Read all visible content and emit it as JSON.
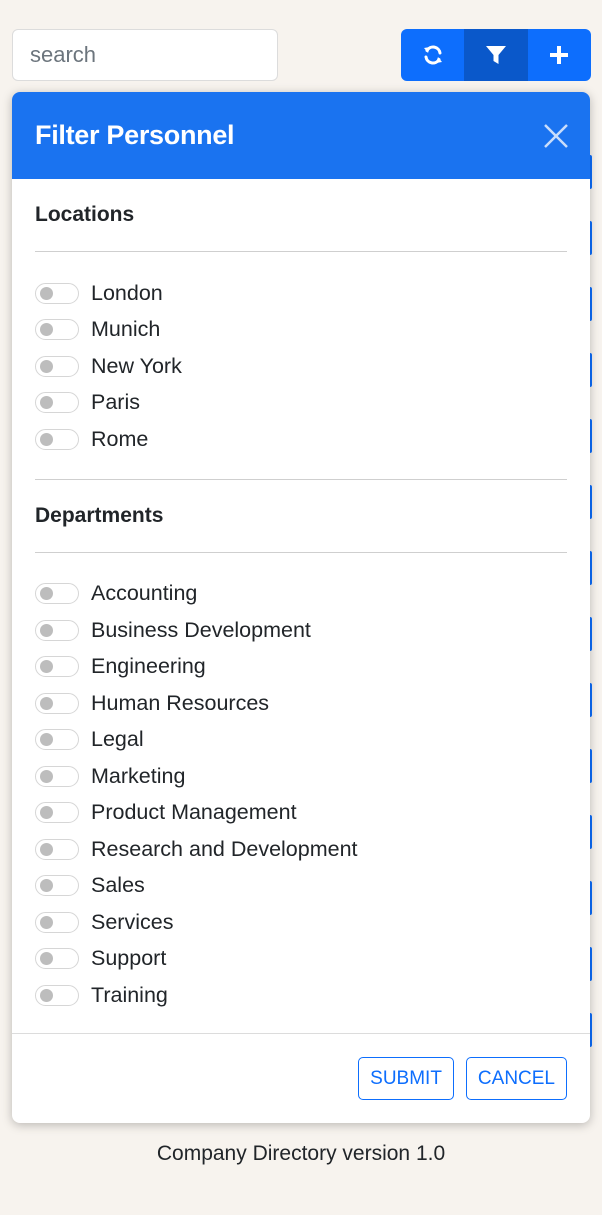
{
  "search": {
    "placeholder": "search"
  },
  "toolbar": {
    "buttons": [
      {
        "icon": "refresh-icon",
        "active": false
      },
      {
        "icon": "filter-icon",
        "active": true
      },
      {
        "icon": "plus-icon",
        "active": false
      }
    ]
  },
  "modal": {
    "title": "Filter Personnel",
    "locations_title": "Locations",
    "locations": [
      "London",
      "Munich",
      "New York",
      "Paris",
      "Rome"
    ],
    "departments_title": "Departments",
    "departments": [
      "Accounting",
      "Business Development",
      "Engineering",
      "Human Resources",
      "Legal",
      "Marketing",
      "Product Management",
      "Research and Development",
      "Sales",
      "Services",
      "Support",
      "Training"
    ],
    "submit_label": "SUBMIT",
    "cancel_label": "CANCEL"
  },
  "footer": {
    "text": "Company Directory version 1.0"
  },
  "colors": {
    "primary": "#0d6efd",
    "header": "#1a73f0",
    "background": "#f7f3ee"
  }
}
